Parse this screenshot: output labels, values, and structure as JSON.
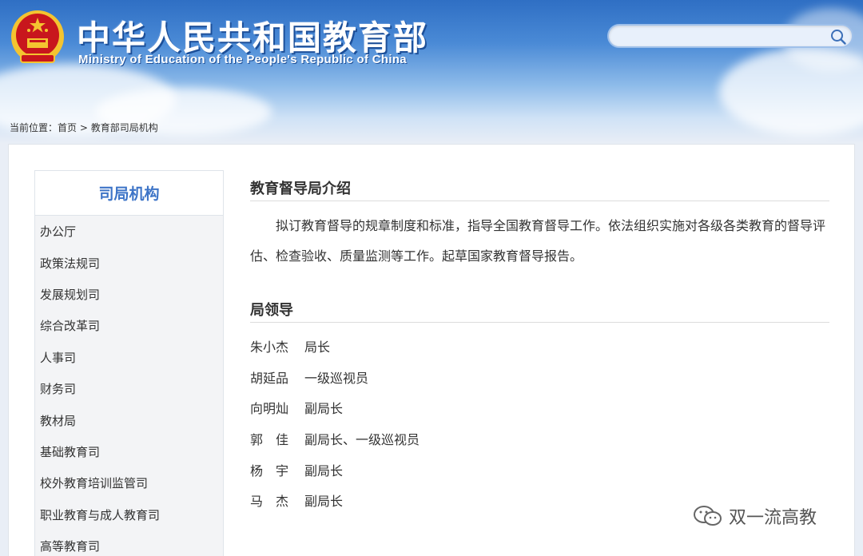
{
  "header": {
    "title_cn": "中华人民共和国教育部",
    "title_en": "Ministry of Education of the People's Republic of China",
    "search": {
      "placeholder": "",
      "value": ""
    }
  },
  "breadcrumb": {
    "prefix": "当前位置：",
    "home": "首页",
    "separator": " > ",
    "current": "教育部司局机构"
  },
  "sidebar": {
    "title": "司局机构",
    "items": [
      {
        "label": "办公厅"
      },
      {
        "label": "政策法规司"
      },
      {
        "label": "发展规划司"
      },
      {
        "label": "综合改革司"
      },
      {
        "label": "人事司"
      },
      {
        "label": "财务司"
      },
      {
        "label": "教材局"
      },
      {
        "label": "基础教育司"
      },
      {
        "label": "校外教育培训监管司"
      },
      {
        "label": "职业教育与成人教育司"
      },
      {
        "label": "高等教育司"
      }
    ]
  },
  "content": {
    "intro_title": "教育督导局介绍",
    "intro_text": "拟订教育督导的规章制度和标准，指导全国教育督导工作。依法组织实施对各级各类教育的督导评估、检查验收、质量监测等工作。起草国家教育督导报告。",
    "leaders_title": "局领导",
    "leaders": [
      {
        "name": "朱小杰",
        "title": "局长"
      },
      {
        "name": "胡延品",
        "title": "一级巡视员"
      },
      {
        "name": "向明灿",
        "title": "副局长"
      },
      {
        "name": "郭　佳",
        "title": "副局长、一级巡视员"
      },
      {
        "name": "杨　宇",
        "title": "副局长"
      },
      {
        "name": "马　杰",
        "title": "副局长"
      }
    ]
  },
  "watermark": {
    "text": "双一流高教"
  },
  "colors": {
    "accent": "#3d74c7",
    "header_blue": "#2f6fc4",
    "emblem_red": "#c8161d",
    "emblem_gold": "#f4c430"
  },
  "icons": {
    "emblem": "national-emblem",
    "search": "search-icon",
    "watermark": "wechat-icon"
  }
}
